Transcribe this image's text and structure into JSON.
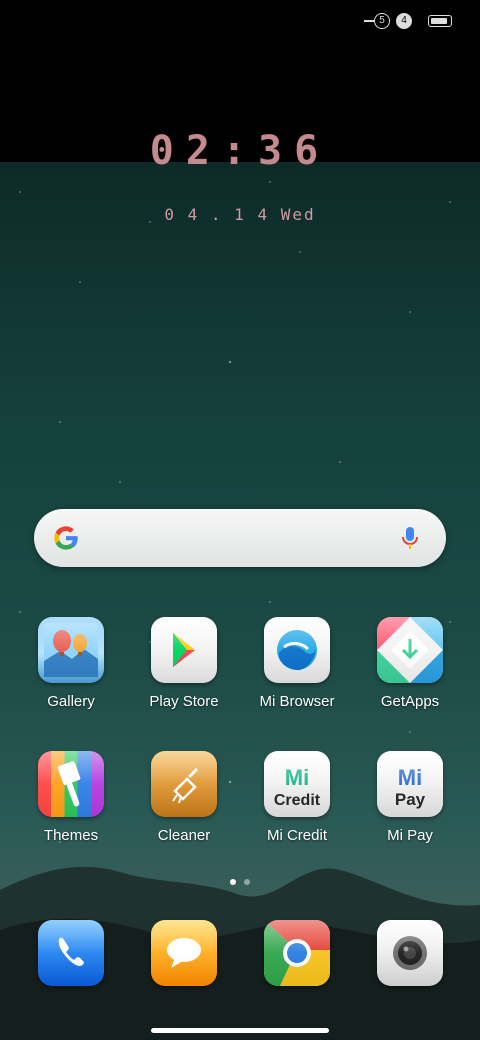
{
  "status_bar": {
    "sim1": "5",
    "sim2": "4"
  },
  "lockscreen_clock": {
    "time": "02:36",
    "date": "0 4 . 1 4  Wed"
  },
  "search_bar": {
    "logo_icon": "google-g-icon",
    "mic_icon": "mic-icon"
  },
  "apps": {
    "row1": [
      {
        "label": "Gallery",
        "icon": "gallery-icon"
      },
      {
        "label": "Play Store",
        "icon": "play-store-icon"
      },
      {
        "label": "Mi Browser",
        "icon": "mi-browser-icon"
      },
      {
        "label": "GetApps",
        "icon": "getapps-icon"
      }
    ],
    "row2": [
      {
        "label": "Themes",
        "icon": "themes-icon"
      },
      {
        "label": "Cleaner",
        "icon": "cleaner-icon"
      },
      {
        "label": "Mi Credit",
        "icon": "mi-credit-icon",
        "tile_text_1": "Mi",
        "tile_text_2": "Credit"
      },
      {
        "label": "Mi Pay",
        "icon": "mi-pay-icon",
        "tile_text_1": "Mi",
        "tile_text_2": "Pay"
      }
    ]
  },
  "page_indicator": {
    "pages": 2,
    "active": 1
  },
  "dock": [
    {
      "icon": "phone-icon"
    },
    {
      "icon": "messages-icon"
    },
    {
      "icon": "chrome-icon"
    },
    {
      "icon": "camera-icon"
    }
  ],
  "colors": {
    "clock": "#c48a8e",
    "wallpaper_top": "#0d2a27",
    "wallpaper_mid": "#1c4a45"
  }
}
